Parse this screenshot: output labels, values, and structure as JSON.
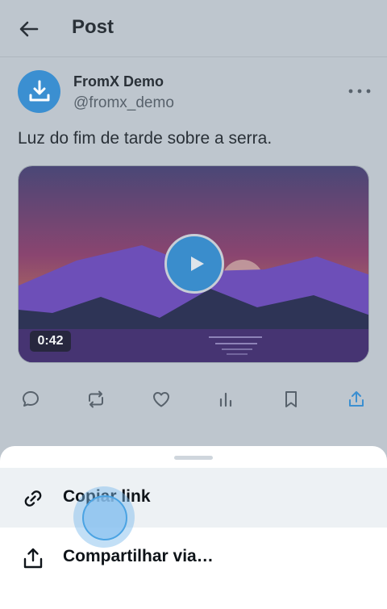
{
  "header": {
    "title": "Post",
    "back_icon": "arrow-left-icon"
  },
  "post": {
    "author_name": "FromX Demo",
    "author_handle": "@fromx_demo",
    "avatar_icon": "download-icon",
    "text": "Luz do fim de tarde sobre a serra.",
    "media": {
      "duration": "0:42",
      "play_icon": "play-icon"
    },
    "actions": [
      {
        "name": "reply",
        "icon": "comment-icon"
      },
      {
        "name": "repost",
        "icon": "repost-icon"
      },
      {
        "name": "like",
        "icon": "heart-icon"
      },
      {
        "name": "views",
        "icon": "bar-chart-icon"
      },
      {
        "name": "bookmark",
        "icon": "bookmark-icon"
      },
      {
        "name": "share",
        "icon": "share-icon"
      }
    ]
  },
  "sheet": {
    "items": [
      {
        "label": "Copiar link",
        "icon": "link-icon"
      },
      {
        "label": "Compartilhar via…",
        "icon": "share-icon"
      }
    ]
  },
  "colors": {
    "accent": "#3b8fd1",
    "background": "#bec6ce",
    "sheet": "#ffffff"
  }
}
